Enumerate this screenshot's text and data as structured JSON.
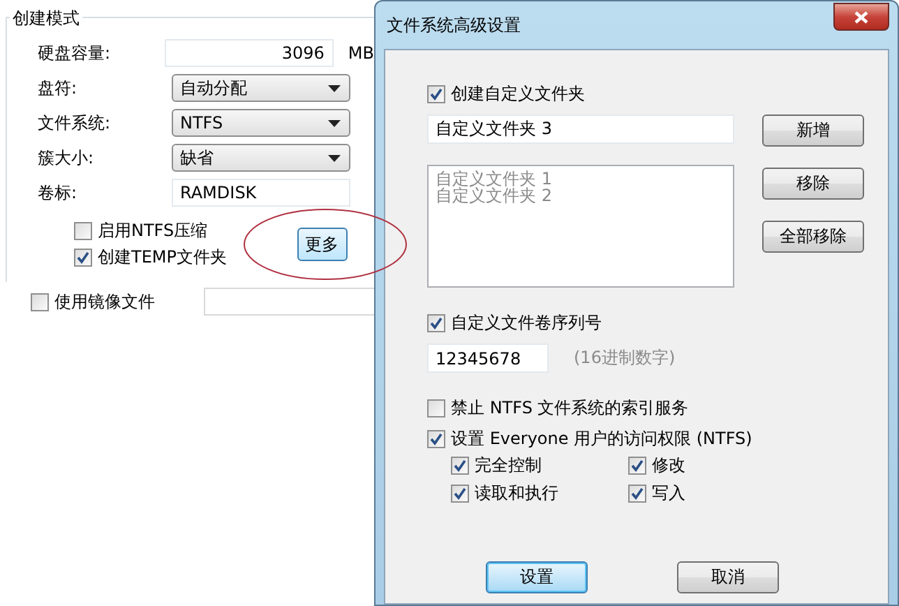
{
  "create_panel": {
    "group_title": "创建模式",
    "fields": [
      {
        "kind": "number",
        "label": "硬盘容量:",
        "value": "3096",
        "unit": "MB"
      },
      {
        "kind": "select",
        "label": "盘符:",
        "value": "自动分配"
      },
      {
        "kind": "select",
        "label": "文件系统:",
        "value": "NTFS"
      },
      {
        "kind": "select",
        "label": "簇大小:",
        "value": "缺省"
      },
      {
        "kind": "text",
        "label": "卷标:",
        "value": "RAMDISK"
      }
    ],
    "options": [
      {
        "label": "启用NTFS压缩",
        "checked": false
      },
      {
        "label": "创建TEMP文件夹",
        "checked": true
      }
    ],
    "more_button": "更多",
    "mirror": {
      "label": "使用镜像文件",
      "checked": false
    }
  },
  "dialog": {
    "title": "文件系统高级设置",
    "custom_folder": {
      "label": "创建自定义文件夹",
      "checked": true
    },
    "folder_input": "自定义文件夹 3",
    "folders": [
      "自定义文件夹 1",
      "自定义文件夹 2"
    ],
    "side_buttons": [
      "新增",
      "移除",
      "全部移除"
    ],
    "serial": {
      "label": "自定义文件卷序列号",
      "checked": true,
      "value": "12345678",
      "hint": "(16进制数字)"
    },
    "options": [
      {
        "label": "禁止 NTFS 文件系统的索引服务",
        "checked": false
      },
      {
        "label": "设置 Everyone 用户的访问权限 (NTFS)",
        "checked": true
      }
    ],
    "permissions": [
      {
        "label": "完全控制",
        "checked": true
      },
      {
        "label": "修改",
        "checked": true
      },
      {
        "label": "读取和执行",
        "checked": true
      },
      {
        "label": "写入",
        "checked": true
      }
    ],
    "buttons": [
      {
        "label": "设置",
        "default": true
      },
      {
        "label": "取消",
        "default": false
      }
    ]
  }
}
